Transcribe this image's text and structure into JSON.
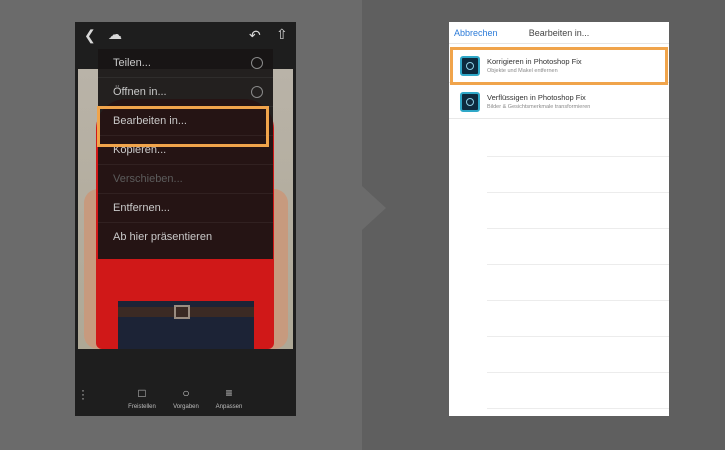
{
  "left_screen": {
    "top_icons": {
      "back": "chevron-left-icon",
      "cloud": "cloud-icon",
      "undo": "undo-icon",
      "share": "share-icon"
    },
    "menu": {
      "items": [
        {
          "label": "Teilen...",
          "disabled": false,
          "has_icon": true
        },
        {
          "label": "Öffnen in...",
          "disabled": false,
          "has_icon": true
        },
        {
          "label": "Bearbeiten in...",
          "disabled": false,
          "has_icon": false,
          "highlighted": true
        },
        {
          "label": "Kopieren...",
          "disabled": false,
          "has_icon": false
        },
        {
          "label": "Verschieben...",
          "disabled": true,
          "has_icon": false
        },
        {
          "label": "Entfernen...",
          "disabled": false,
          "has_icon": false
        },
        {
          "label": "Ab hier präsentieren",
          "disabled": false,
          "has_icon": false
        }
      ]
    },
    "toolbar": {
      "crop_label": "Freistellen",
      "presets_label": "Vorgaben",
      "adjust_label": "Anpassen"
    }
  },
  "right_screen": {
    "header": {
      "cancel_label": "Abbrechen",
      "title": "Bearbeiten in..."
    },
    "items": [
      {
        "title": "Korrigieren in Photoshop Fix",
        "subtitle": "Objekte und Makel entfernen",
        "highlighted": true
      },
      {
        "title": "Verflüssigen in Photoshop Fix",
        "subtitle": "Bilder & Gesichtsmerkmale transformieren",
        "highlighted": false
      }
    ]
  },
  "colors": {
    "highlight": "#f0a44b",
    "link": "#2c7bd8",
    "shirt": "#d01818"
  }
}
